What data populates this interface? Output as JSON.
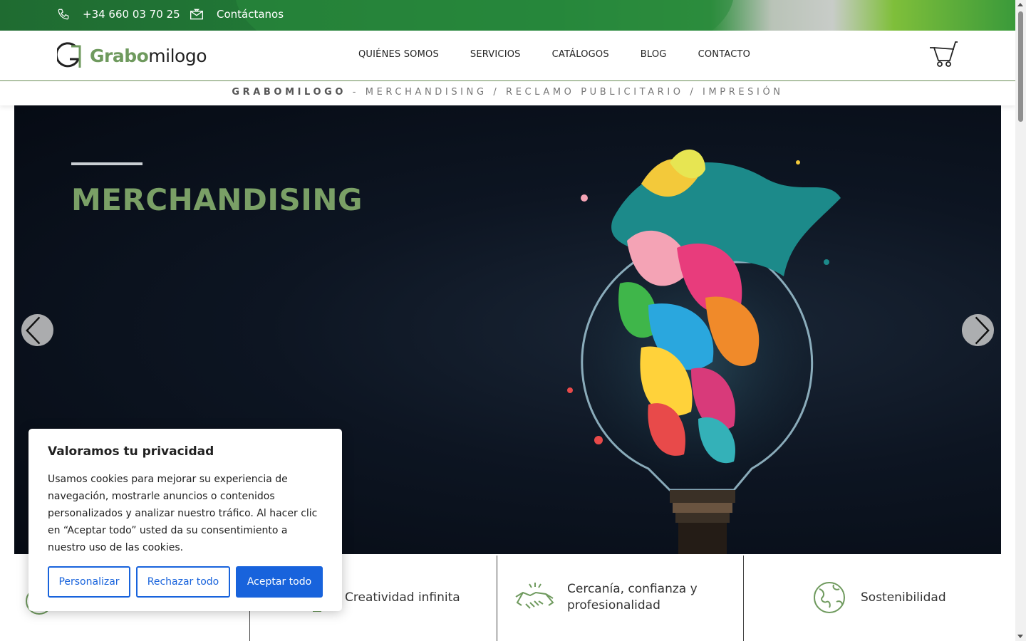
{
  "topbar": {
    "phone": "+34 660 03 70 25",
    "contact": "Contáctanos"
  },
  "header": {
    "logo_part1": "Grabo",
    "logo_part2": "milogo",
    "nav": [
      "QUIÉNES SOMOS",
      "SERVICIOS",
      "CATÁLOGOS",
      "BLOG",
      "CONTACTO"
    ]
  },
  "tagline": {
    "brand": "GRABOMILOGO",
    "rest": " - MERCHANDISING / RECLAMO PUBLICITARIO / IMPRESIÓN"
  },
  "hero": {
    "title": "MERCHANDISING"
  },
  "features": [
    {
      "label": "Creatividad infinita",
      "icon": "lightbulb-icon"
    },
    {
      "label": "Cercanía, confianza y profesionalidad",
      "icon": "handshake-icon"
    },
    {
      "label": "Sostenibilidad",
      "icon": "globe-icon"
    }
  ],
  "cookie": {
    "title": "Valoramos tu privacidad",
    "text": "Usamos cookies para mejorar su experiencia de navegación, mostrarle anuncios o contenidos personalizados y analizar nuestro tráfico. Al hacer clic en “Aceptar todo” usted da su consentimiento a nuestro uso de las cookies.",
    "customize": "Personalizar",
    "reject": "Rechazar todo",
    "accept": "Aceptar todo"
  },
  "colors": {
    "brand_green": "#6f9a5e",
    "topbar_green": "#23843b",
    "cookie_blue": "#1863dc",
    "hero_bg": "#0b1322"
  }
}
